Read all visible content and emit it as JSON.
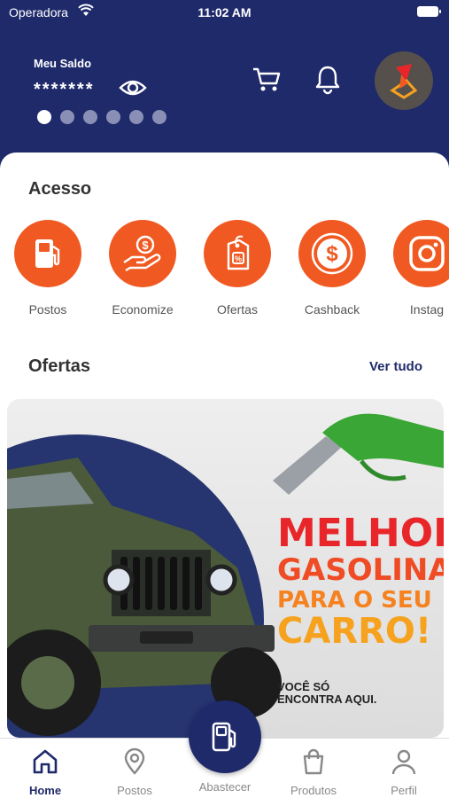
{
  "status_bar": {
    "carrier": "Operadora",
    "time": "11:02 AM"
  },
  "header": {
    "balance_label": "Meu Saldo",
    "balance_value": "*******",
    "carousel_dots": 6,
    "active_dot": 0
  },
  "access": {
    "title": "Acesso",
    "items": [
      {
        "label": "Postos",
        "icon": "fuel-pump-icon"
      },
      {
        "label": "Economize",
        "icon": "coin-hand-icon"
      },
      {
        "label": "Ofertas",
        "icon": "price-tag-icon"
      },
      {
        "label": "Cashback",
        "icon": "dollar-coin-icon"
      },
      {
        "label": "Instag",
        "icon": "instagram-icon"
      }
    ]
  },
  "offers": {
    "title": "Ofertas",
    "see_all": "Ver tudo",
    "banner": {
      "line1": "MELHOR",
      "line2": "GASOLINA",
      "line3": "PARA O SEU",
      "line4": "CARRO!",
      "sub": "VOCÊ SÓ ENCONTRA AQUI."
    }
  },
  "bottom_nav": {
    "items": [
      {
        "label": "Home",
        "icon": "home-icon",
        "active": true
      },
      {
        "label": "Postos",
        "icon": "map-pin-icon",
        "active": false
      },
      {
        "label": "Abastecer",
        "icon": "fuel-pump-icon",
        "active": false
      },
      {
        "label": "Produtos",
        "icon": "shopping-bag-icon",
        "active": false
      },
      {
        "label": "Perfil",
        "icon": "user-icon",
        "active": false
      }
    ]
  },
  "colors": {
    "primary": "#1f2a6b",
    "accent": "#f05a22"
  }
}
